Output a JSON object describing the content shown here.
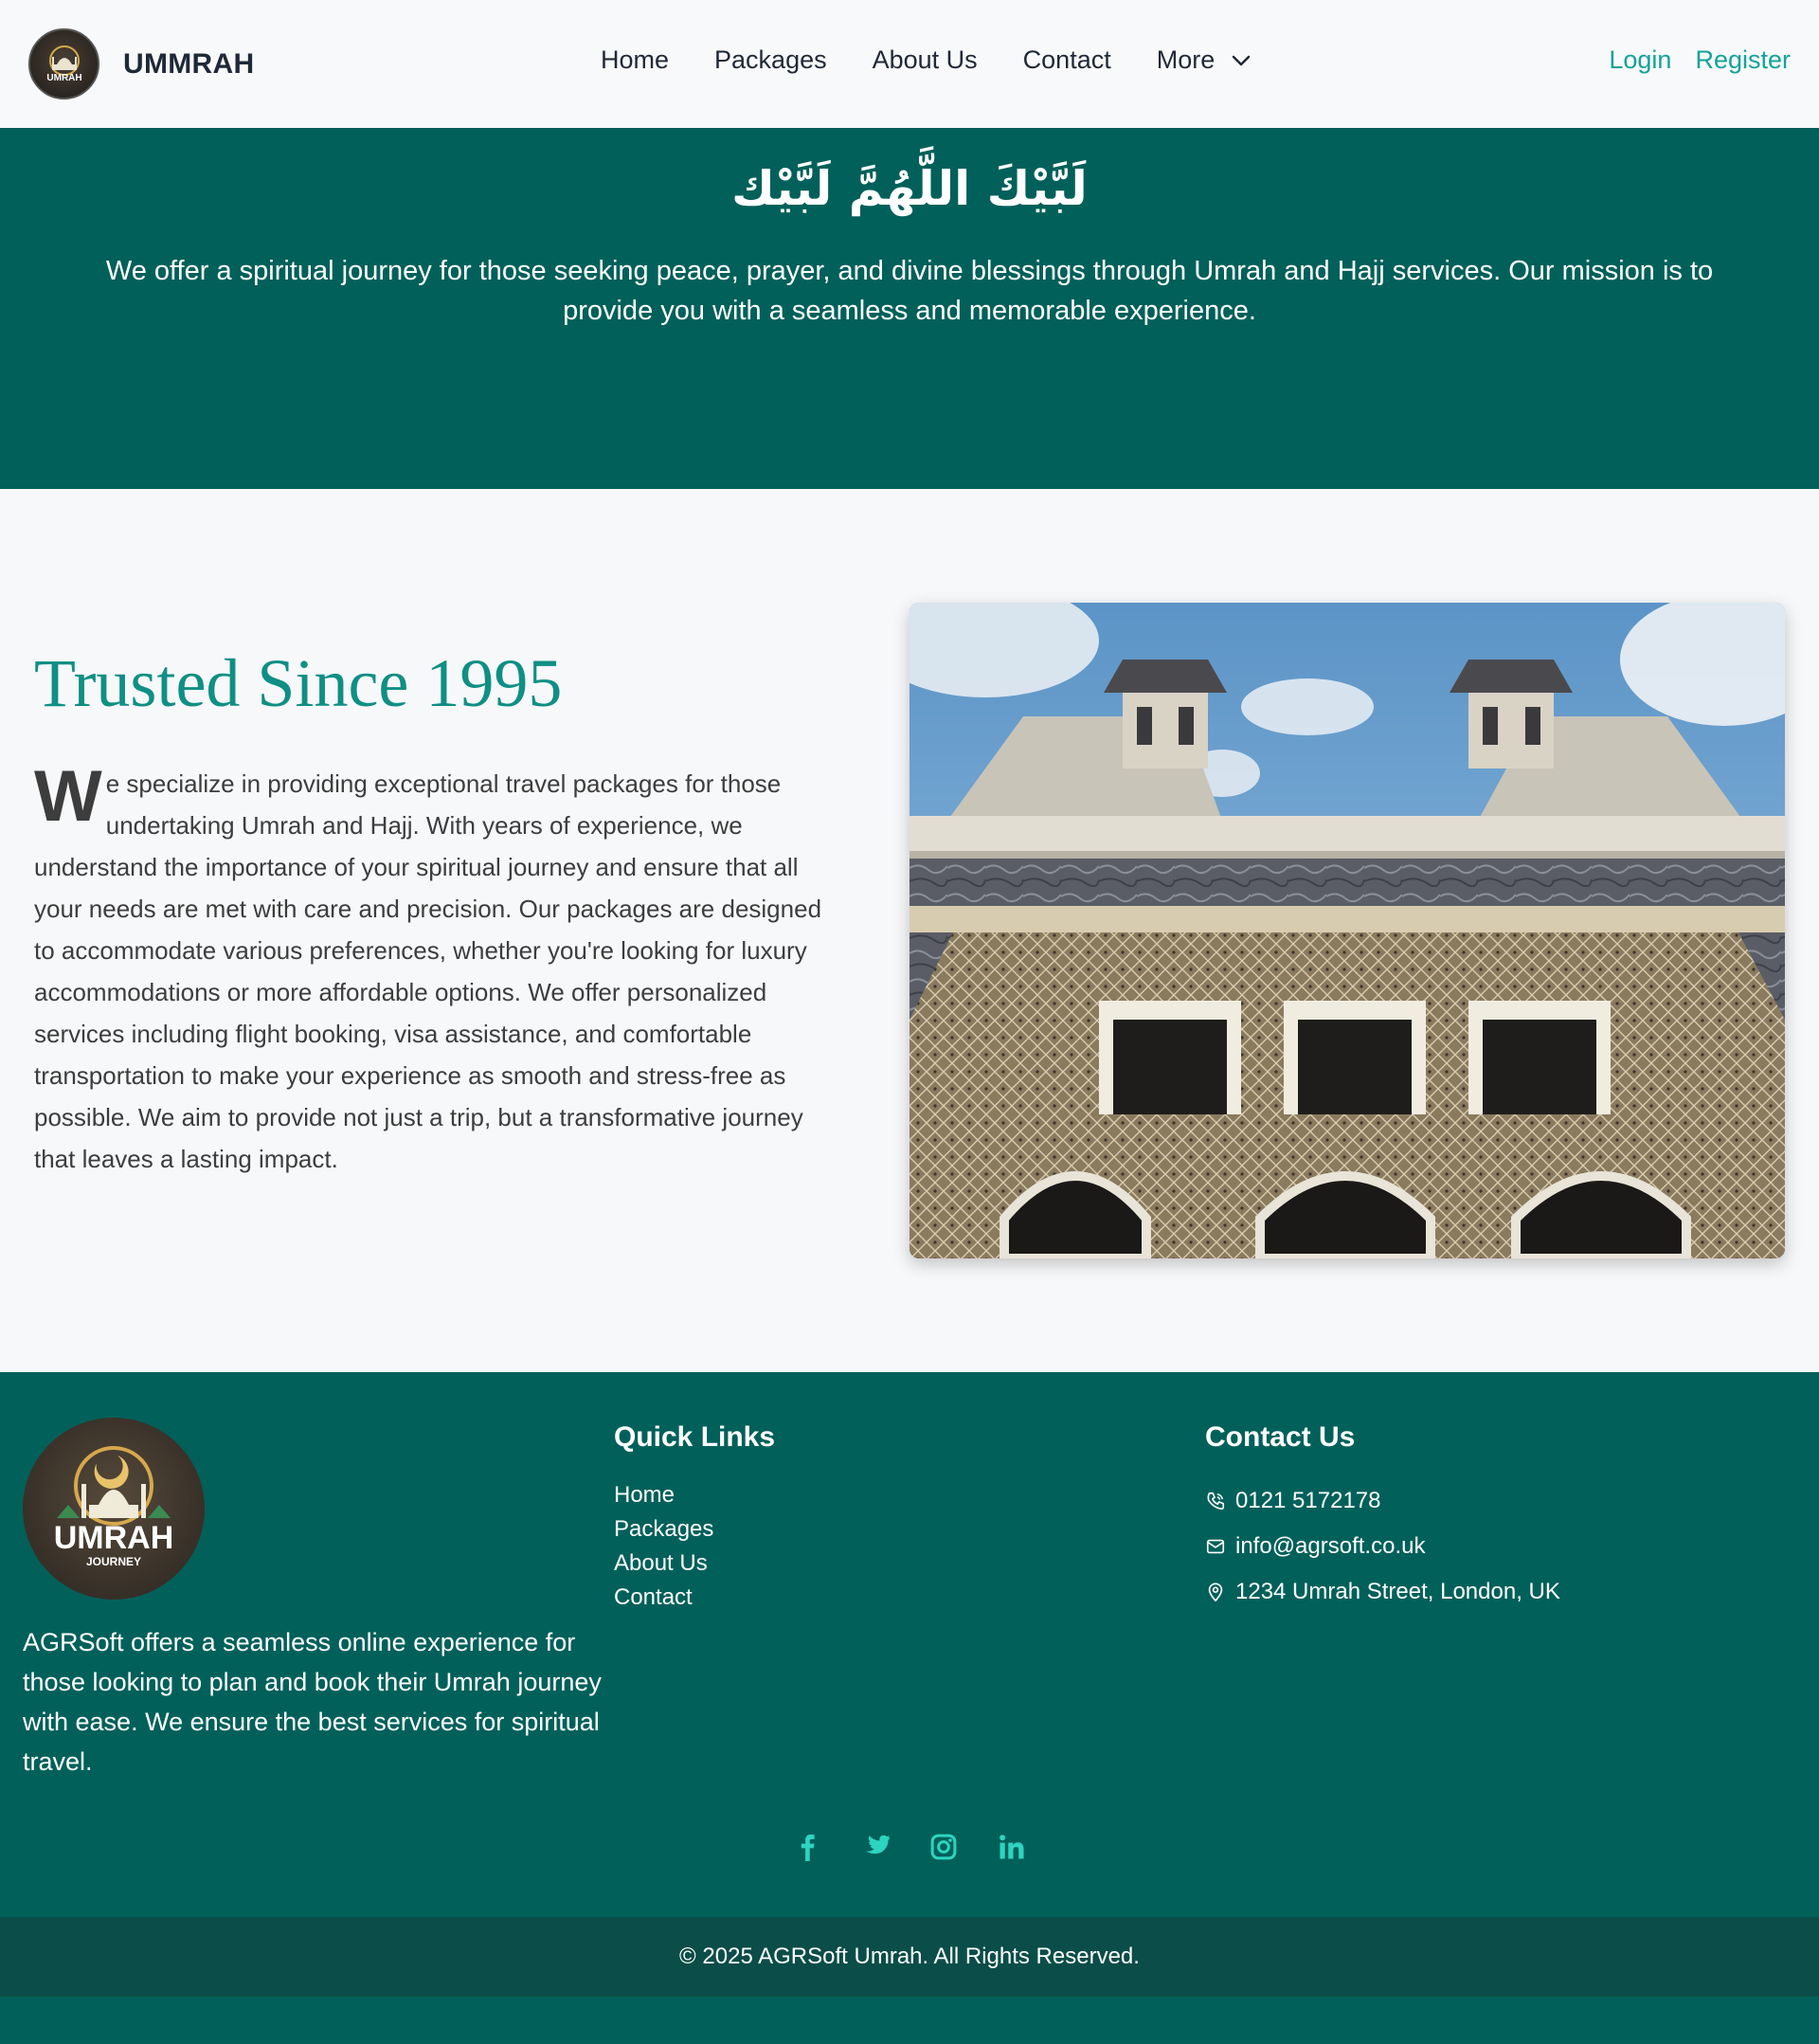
{
  "nav": {
    "brand": "UMMRAH",
    "logo_text": "UMRAH",
    "links": [
      "Home",
      "Packages",
      "About Us",
      "Contact"
    ],
    "more": "More",
    "login": "Login",
    "register": "Register"
  },
  "hero": {
    "arabic": "لَبَّيْكَ اللَّهُمَّ لَبَّيْك",
    "text": "We offer a spiritual journey for those seeking peace, prayer, and divine blessings through Umrah and Hajj services. Our mission is to provide you with a seamless and memorable experience."
  },
  "about": {
    "title": "Trusted Since 1995",
    "drop_cap": "W",
    "text": "e specialize in providing exceptional travel packages for those undertaking Umrah and Hajj. With years of experience, we understand the importance of your spiritual journey and ensure that all your needs are met with care and precision. Our packages are designed to accommodate various preferences, whether you're looking for luxury accommodations or more affordable options. We offer personalized services including flight booking, visa assistance, and comfortable transportation to make your experience as smooth and stress-free as possible. We aim to provide not just a trip, but a transformative journey that leaves a lasting impact."
  },
  "footer": {
    "logo_text": "UMRAH",
    "logo_subtext": "JOURNEY",
    "about": "AGRSoft offers a seamless online experience for those looking to plan and book their Umrah journey with ease. We ensure the best services for spiritual travel.",
    "quick_links_heading": "Quick Links",
    "quick_links": [
      "Home",
      "Packages",
      "About Us",
      "Contact"
    ],
    "contact_heading": "Contact Us",
    "phone": "0121 5172178",
    "email": "info@agrsoft.co.uk",
    "address": "1234 Umrah Street, London, UK",
    "socials": [
      "facebook-icon",
      "twitter-icon",
      "instagram-icon",
      "linkedin-icon"
    ],
    "copyright": "© 2025 AGRSoft Umrah. All Rights Reserved."
  },
  "colors": {
    "primary": "#02605a",
    "accent": "#14a39a",
    "title": "#0f8f85",
    "social": "#2dd4bf",
    "copyright_bg": "#0b4d48"
  }
}
